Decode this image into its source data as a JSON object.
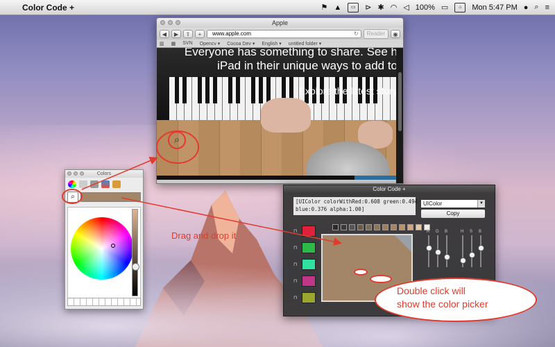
{
  "menubar": {
    "apple_glyph": "",
    "app_name": "Color Code +",
    "battery": "100%",
    "clock": "Mon 5:47 PM"
  },
  "safari": {
    "title": "Apple",
    "url": "www.apple.com",
    "reader": "Reader",
    "bookmarks": [
      "SVN",
      "Opencv ▾",
      "Cocoa Dev ▾",
      "English ▾",
      "untitled folder ▾"
    ],
    "hero_line1": "Everyone has something to share. See h",
    "hero_line2": "iPad in their unique ways to add to",
    "hero_line3": "Explore the latest story"
  },
  "colors_panel": {
    "title": "Colors",
    "current_color": "#a38567"
  },
  "colorcode_panel": {
    "title": "Color Code +",
    "code_text": "[UIColor colorWithRed:0.608 green:0.494\nblue:0.376 alpha:1.00]",
    "format": "UIColor",
    "copy_label": "Copy",
    "swatches": [
      "#e0213a",
      "#2eb84a",
      "#2fe0a0",
      "#c0378a",
      "#9aa62e"
    ],
    "small_swatches": [
      "#2a2a2a",
      "#3a3a3a",
      "#555555",
      "#6a5a48",
      "#7a6a58",
      "#8a765e",
      "#9a8060",
      "#a38567",
      "#b49370",
      "#c8a886",
      "#e0c8a8",
      "#f4f0e8"
    ],
    "rgb_labels": [
      "R",
      "G",
      "B"
    ],
    "hsb_labels": [
      "H",
      "S",
      "B"
    ],
    "big_color": "#a38567"
  },
  "annotations": {
    "drag_text": "Drag and drop it",
    "bubble_line1": "Double click will",
    "bubble_line2": "show the color picker",
    "accent": "#e23b2e"
  }
}
